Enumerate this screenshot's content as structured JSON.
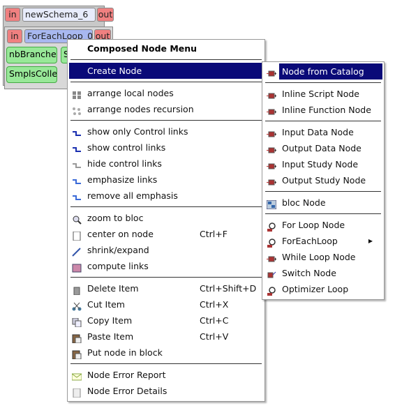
{
  "schema": {
    "in": "in",
    "name": "newSchema_6",
    "out": "out"
  },
  "foreach": {
    "in": "in",
    "name": "ForEachLoop_0",
    "out": "out",
    "nodes": [
      "nbBranches",
      "SmplsCollector",
      "S"
    ]
  },
  "menu": {
    "title": "Composed Node Menu",
    "groups": [
      [
        {
          "label": "Create Node",
          "icon": "create-node-icon",
          "highlighted": true
        }
      ],
      [
        {
          "label": "arrange local nodes",
          "icon": "arrange-local-icon"
        },
        {
          "label": "arrange nodes recursion",
          "icon": "arrange-recursion-icon"
        }
      ],
      [
        {
          "label": "show only Control links",
          "icon": "control-link-icon"
        },
        {
          "label": "show control links",
          "icon": "control-link-icon"
        },
        {
          "label": "hide control links",
          "icon": "control-link-grey-icon"
        },
        {
          "label": "emphasize links",
          "icon": "emphasize-link-icon"
        },
        {
          "label": "remove all emphasis",
          "icon": "emphasize-link-icon"
        }
      ],
      [
        {
          "label": "zoom to bloc",
          "icon": "zoom-icon"
        },
        {
          "label": "center on node",
          "icon": "page-icon",
          "shortcut": "Ctrl+F"
        },
        {
          "label": "shrink/expand",
          "icon": "shrink-expand-icon"
        },
        {
          "label": "compute links",
          "icon": "compute-links-icon"
        }
      ],
      [
        {
          "label": "Delete Item",
          "icon": "trash-icon",
          "shortcut": "Ctrl+Shift+D"
        },
        {
          "label": "Cut Item",
          "icon": "scissors-icon",
          "shortcut": "Ctrl+X"
        },
        {
          "label": "Copy Item",
          "icon": "copy-icon",
          "shortcut": "Ctrl+C"
        },
        {
          "label": "Paste Item",
          "icon": "paste-icon",
          "shortcut": "Ctrl+V"
        },
        {
          "label": "Put node in block",
          "icon": "paste-icon"
        }
      ],
      [
        {
          "label": "Node Error Report",
          "icon": "envelope-icon"
        },
        {
          "label": "Node Error Details",
          "icon": "document-icon"
        }
      ]
    ]
  },
  "submenu": {
    "groups": [
      [
        {
          "label": "Node from Catalog",
          "icon": "node-icon",
          "highlighted": true
        }
      ],
      [
        {
          "label": "Inline Script Node",
          "icon": "node-icon"
        },
        {
          "label": "Inline Function Node",
          "icon": "node-icon"
        }
      ],
      [
        {
          "label": "Input Data Node",
          "icon": "node-icon"
        },
        {
          "label": "Output Data Node",
          "icon": "node-icon"
        },
        {
          "label": "Input Study Node",
          "icon": "node-icon"
        },
        {
          "label": "Output Study Node",
          "icon": "node-icon"
        }
      ],
      [
        {
          "label": "bloc Node",
          "icon": "bloc-icon"
        }
      ],
      [
        {
          "label": "For Loop Node",
          "icon": "loop-icon"
        },
        {
          "label": "ForEachLoop",
          "icon": "loop-icon",
          "submenu": true
        },
        {
          "label": "While Loop Node",
          "icon": "node-icon"
        },
        {
          "label": "Switch Node",
          "icon": "switch-icon"
        },
        {
          "label": "Optimizer Loop",
          "icon": "loop-icon"
        }
      ]
    ]
  },
  "colors": {
    "highlight": "#0a0a78",
    "port": "#f08080",
    "node": "#98e898",
    "loop": "#a8b8f0"
  }
}
